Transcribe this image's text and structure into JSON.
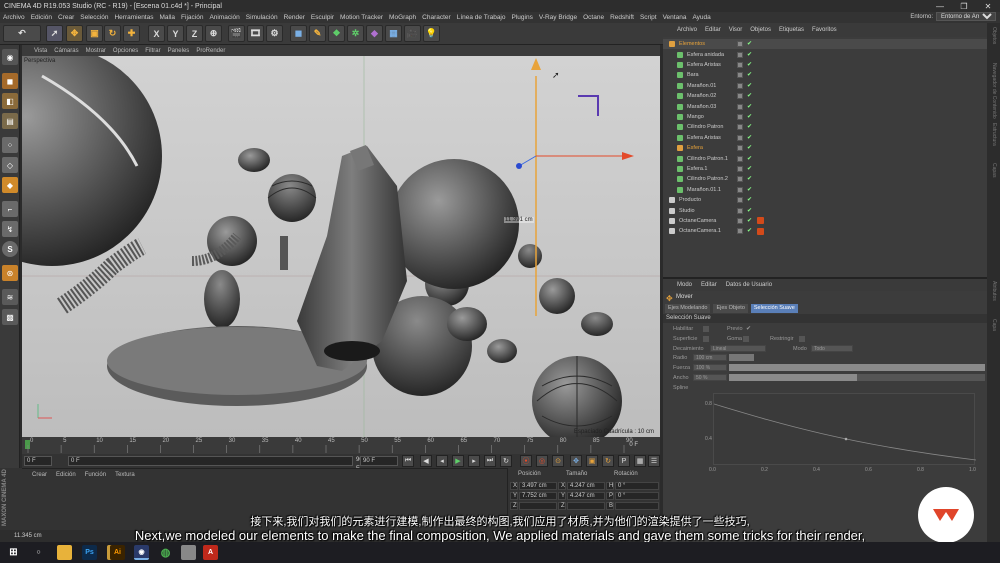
{
  "window": {
    "title": "CINEMA 4D R19.053 Studio (RC - R19) - [Escena 01.c4d *] - Principal",
    "controls": [
      "—",
      "❐",
      "✕"
    ]
  },
  "menubar": {
    "items": [
      "Archivo",
      "Edición",
      "Crear",
      "Selección",
      "Herramientas",
      "Malla",
      "Fijación",
      "Animación",
      "Simulación",
      "Render",
      "Esculpir",
      "Motion Tracker",
      "MoGraph",
      "Character",
      "Línea de Trabajo",
      "Plugins",
      "V-Ray Bridge",
      "Octane",
      "Redshift",
      "Script",
      "Ventana",
      "Ayuda"
    ],
    "layout_label": "Entorno:",
    "layout_value": "Entorno de Arranque"
  },
  "toolbar": {
    "axis_x": "X",
    "axis_y": "Y",
    "axis_z": "Z"
  },
  "left_tools": {
    "solo_label": "S"
  },
  "viewport": {
    "menu": [
      "Vista",
      "Cámaras",
      "Mostrar",
      "Opciones",
      "Filtrar",
      "Paneles",
      "ProRender"
    ],
    "label": "Perspectiva",
    "measure": "11.391 cm",
    "grid_spacing": "Espaciado Cuadrícula : 10 cm"
  },
  "timeline": {
    "ticks": [
      "0",
      "5",
      "10",
      "15",
      "20",
      "25",
      "30",
      "35",
      "40",
      "45",
      "50",
      "55",
      "60",
      "65",
      "70",
      "75",
      "80",
      "85",
      "90"
    ],
    "end_frame_label": "0 F",
    "start_field": "0 F",
    "min_field": "0 F",
    "max_field": "90 F",
    "end_field": "90 F"
  },
  "material_panel": {
    "menu": [
      "Crear",
      "Edición",
      "Función",
      "Textura"
    ],
    "brand_vertical": "MAXON CINEMA 4D"
  },
  "coordinates": {
    "headers": [
      "Posición",
      "Tamaño",
      "Rotación"
    ],
    "rows": [
      {
        "axis": "X",
        "pos": "3.497 cm",
        "size_axis": "X",
        "size": "4.247 cm",
        "rot_axis": "H",
        "rot": "0 °"
      },
      {
        "axis": "Y",
        "pos": "7.752 cm",
        "size_axis": "Y",
        "size": "4.247 cm",
        "rot_axis": "P",
        "rot": "0 °"
      },
      {
        "axis": "Z",
        "pos": "",
        "size_axis": "Z",
        "size": "",
        "rot_axis": "B",
        "rot": ""
      }
    ]
  },
  "statusbar": {
    "text": "11.345 cm"
  },
  "objects_panel": {
    "menu": [
      "Archivo",
      "Editar",
      "Visor",
      "Objetos",
      "Etiquetas",
      "Favoritos"
    ],
    "items": [
      {
        "name": "Elementos",
        "indent": 0,
        "selected": true,
        "color": "#e0a040"
      },
      {
        "name": "Esfera anidada",
        "indent": 1,
        "selected": false,
        "color": "#6cc06c"
      },
      {
        "name": "Esfera Aristas",
        "indent": 1,
        "selected": false,
        "color": "#6cc06c"
      },
      {
        "name": "Bara",
        "indent": 1,
        "selected": false,
        "color": "#6cc06c"
      },
      {
        "name": "Marañon.01",
        "indent": 1,
        "selected": false,
        "color": "#6cc06c"
      },
      {
        "name": "Marañon.02",
        "indent": 1,
        "selected": false,
        "color": "#6cc06c"
      },
      {
        "name": "Marañon.03",
        "indent": 1,
        "selected": false,
        "color": "#6cc06c"
      },
      {
        "name": "Mango",
        "indent": 1,
        "selected": false,
        "color": "#6cc06c"
      },
      {
        "name": "Cilindro Patron",
        "indent": 1,
        "selected": false,
        "color": "#6cc06c"
      },
      {
        "name": "Esfera Aristas",
        "indent": 1,
        "selected": false,
        "color": "#6cc06c"
      },
      {
        "name": "Esfera",
        "indent": 1,
        "selected": true,
        "color": "#e0a040"
      },
      {
        "name": "Cilindro Patron.1",
        "indent": 1,
        "selected": false,
        "color": "#6cc06c"
      },
      {
        "name": "Esfera.1",
        "indent": 1,
        "selected": false,
        "color": "#6cc06c"
      },
      {
        "name": "Cilindro Patron.2",
        "indent": 1,
        "selected": false,
        "color": "#6cc06c"
      },
      {
        "name": "Marañon.01.1",
        "indent": 1,
        "selected": false,
        "color": "#6cc06c"
      },
      {
        "name": "Producto",
        "indent": 0,
        "selected": false,
        "color": "#cccccc"
      },
      {
        "name": "Studio",
        "indent": 0,
        "selected": false,
        "color": "#cccccc"
      },
      {
        "name": "OctaneCamera",
        "indent": 0,
        "selected": false,
        "color": "#cccccc"
      },
      {
        "name": "OctaneCamera.1",
        "indent": 0,
        "selected": false,
        "color": "#cccccc"
      }
    ]
  },
  "attributes_panel": {
    "menu": [
      "Modo",
      "Editar",
      "Datos de Usuario"
    ],
    "tool_name": "Mover",
    "tabs": [
      "Ejes Modelando",
      "Ejes Objeto",
      "Selección Suave"
    ],
    "active_tab": "Selección Suave",
    "section_title": "Selección Suave",
    "fields": {
      "habilitar": "Habilitar",
      "previo": "Previo",
      "superficie": "Superficie",
      "goma": "Goma",
      "restringir": "Restringir",
      "decaimiento": "Decaimiento",
      "decaimiento_val": "Lineal",
      "modo": "Modo",
      "modo_val": "Todo",
      "radio": "Radio",
      "radio_val": "100 cm",
      "fuerza": "Fuerza",
      "fuerza_val": "100 %",
      "ancho": "Ancho",
      "ancho_val": "50 %",
      "spline": "Spline"
    },
    "fuerza_fill": 1.0,
    "ancho_fill": 0.5,
    "graph_y_ticks": [
      "0.8",
      "0.4"
    ],
    "graph_x_ticks": [
      "0.0",
      "0.2",
      "0.4",
      "0.6",
      "0.8",
      "1.0"
    ]
  },
  "right_strip": {
    "labels": [
      "Objetos",
      "Navegador de Contenido",
      "Estructura",
      "Capas",
      "Atributos",
      "Capa"
    ]
  },
  "subtitles": {
    "zh": "接下来,我们对我们的元素进行建模,制作出最终的构图,我们应用了材质,并为他们的渲染提供了一些技巧,",
    "en": "Next,we modeled our elements to make the final composition, We applied materials and gave them some tricks for their render,"
  },
  "taskbar": {
    "ps_label": "Ps",
    "ai_label": "Ai"
  },
  "colors": {
    "accent_orange": "#e8a33a",
    "brand_red": "#e0452a",
    "selected_tab": "#5a7fb8"
  }
}
